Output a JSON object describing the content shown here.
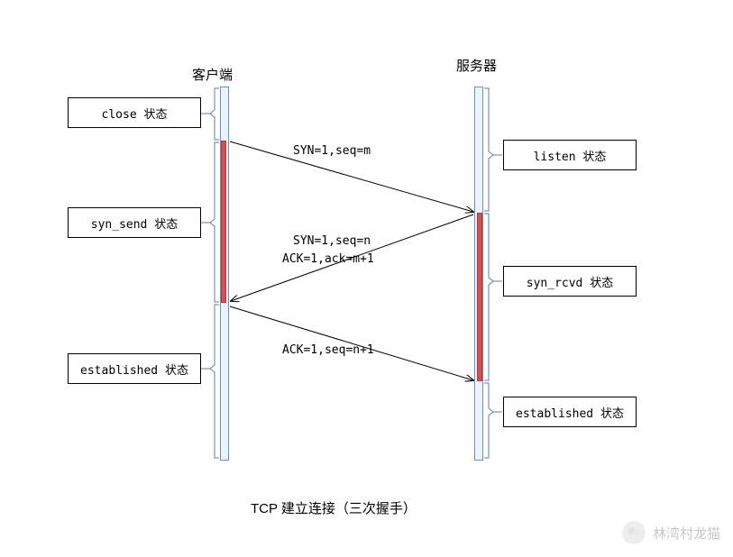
{
  "headers": {
    "client": "客户端",
    "server": "服务器"
  },
  "states": {
    "client_close": "close 状态",
    "client_syn_send": "syn_send 状态",
    "client_established": "established 状态",
    "server_listen": "listen 状态",
    "server_syn_rcvd": "syn_rcvd 状态",
    "server_established": "established 状态"
  },
  "messages": {
    "m1": "SYN=1,seq=m",
    "m2a": "SYN=1,seq=n",
    "m2b": "ACK=1,ack=m+1",
    "m3": "ACK=1,seq=n+1"
  },
  "caption": "TCP 建立连接（三次握手）",
  "watermark": "林湾村龙猫"
}
